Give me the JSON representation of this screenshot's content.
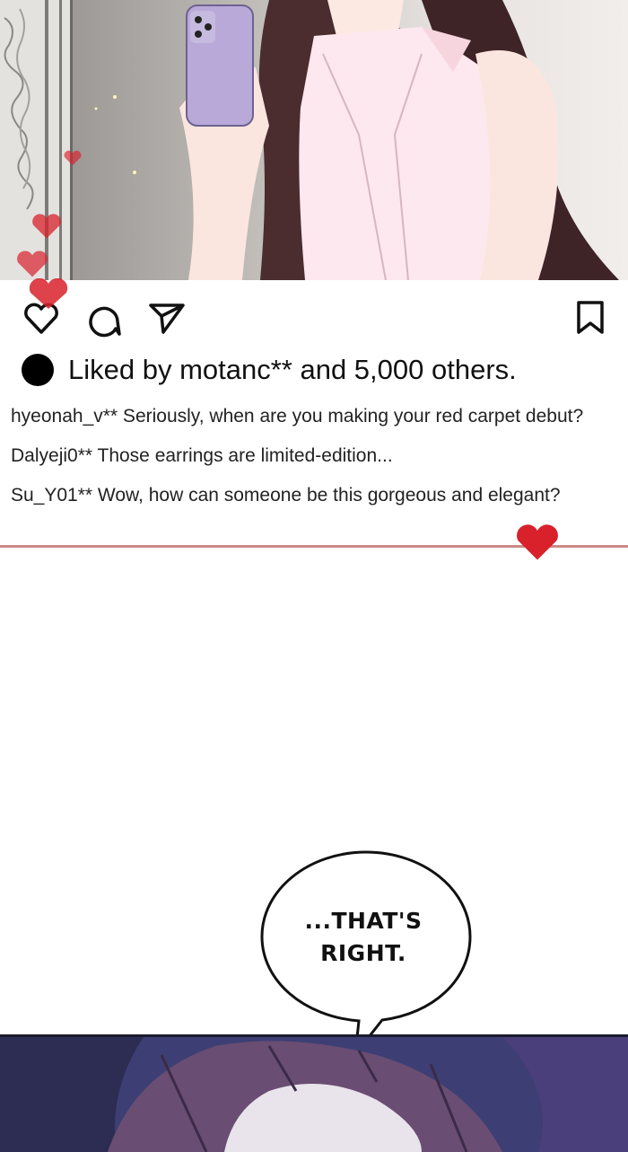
{
  "post": {
    "actions": {
      "like": "heart-icon",
      "comment": "comment-icon",
      "share": "send-icon",
      "save": "bookmark-icon"
    },
    "liked_by": "Liked by motanc** and 5,000 others.",
    "comments": [
      "hyeonah_v** Seriously, when are you making your red carpet debut?",
      "Dalyeji0** Those earrings are limited-edition...",
      "Su_Y01** Wow, how can someone be this gorgeous and elegant?"
    ]
  },
  "speech_bubble": {
    "line1": "...THAT'S",
    "line2": "RIGHT."
  },
  "colors": {
    "heart": "#d8212b",
    "divider": "#c98a86",
    "bottom_panel": "#3b3c6e"
  }
}
